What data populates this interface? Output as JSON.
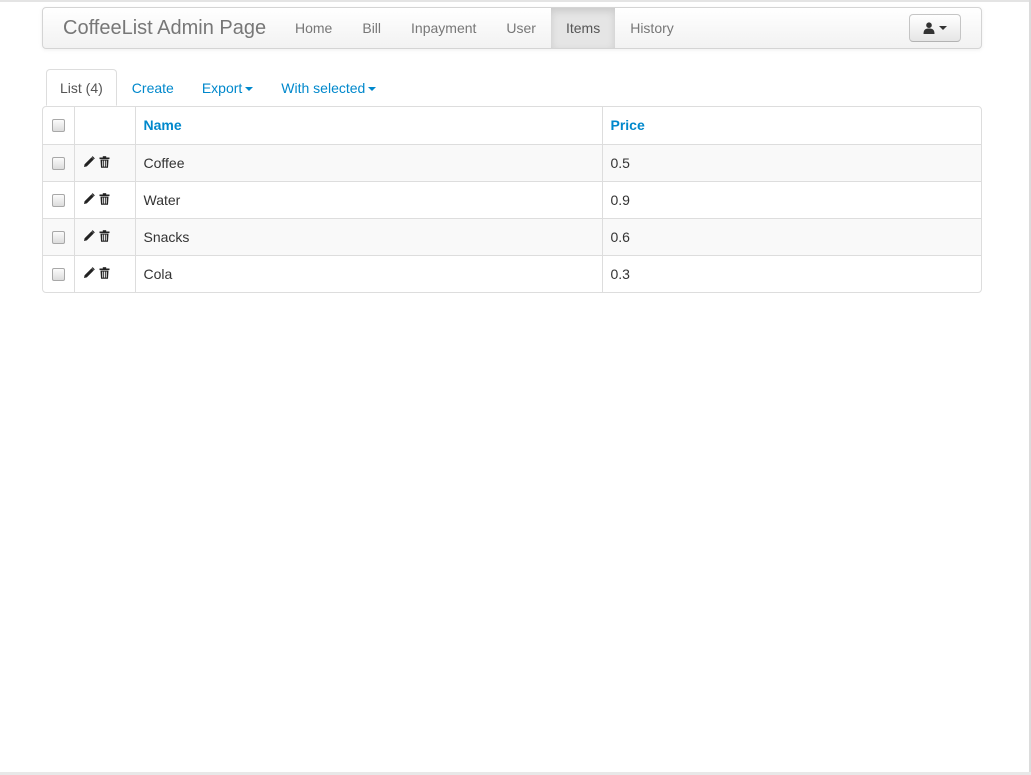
{
  "navbar": {
    "brand": "CoffeeList Admin Page",
    "items": [
      {
        "label": "Home",
        "active": false
      },
      {
        "label": "Bill",
        "active": false
      },
      {
        "label": "Inpayment",
        "active": false
      },
      {
        "label": "User",
        "active": false
      },
      {
        "label": "Items",
        "active": true
      },
      {
        "label": "History",
        "active": false
      }
    ],
    "user_menu_icon": "user-icon"
  },
  "tabs": {
    "list": "List (4)",
    "create": "Create",
    "export": "Export",
    "with_selected": "With selected"
  },
  "table": {
    "columns": {
      "name": "Name",
      "price": "Price"
    },
    "row_action_icons": [
      "pencil-icon",
      "trash-icon"
    ],
    "rows": [
      {
        "name": "Coffee",
        "price": "0.5"
      },
      {
        "name": "Water",
        "price": "0.9"
      },
      {
        "name": "Snacks",
        "price": "0.6"
      },
      {
        "name": "Cola",
        "price": "0.3"
      }
    ]
  },
  "colors": {
    "link": "#0088cc",
    "nav_text": "#777777"
  }
}
